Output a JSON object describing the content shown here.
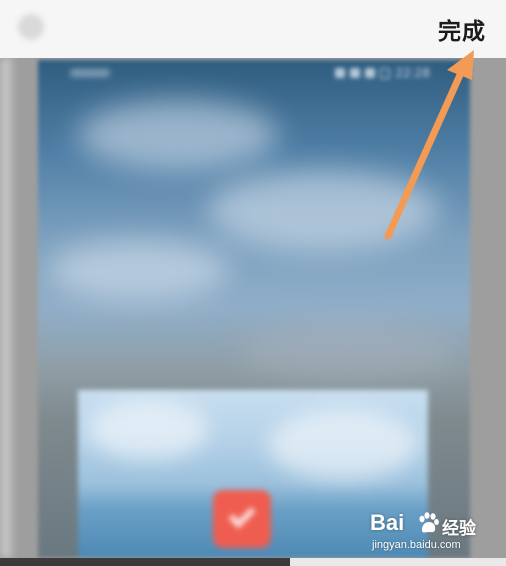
{
  "topbar": {
    "back_icon": "back-icon",
    "done_label": "完成"
  },
  "statusbar": {
    "time": "22:28",
    "battery_label": "–"
  },
  "annotation": {
    "arrow_color": "#f39a55"
  },
  "watermark": {
    "brand": "Bai",
    "brand_suffix": "经验",
    "url": "jingyan.baidu.com"
  },
  "colors": {
    "accent_app_icon": "#ef5d50",
    "topbar_bg": "#f6f6f6",
    "arrow": "#f39a55"
  }
}
